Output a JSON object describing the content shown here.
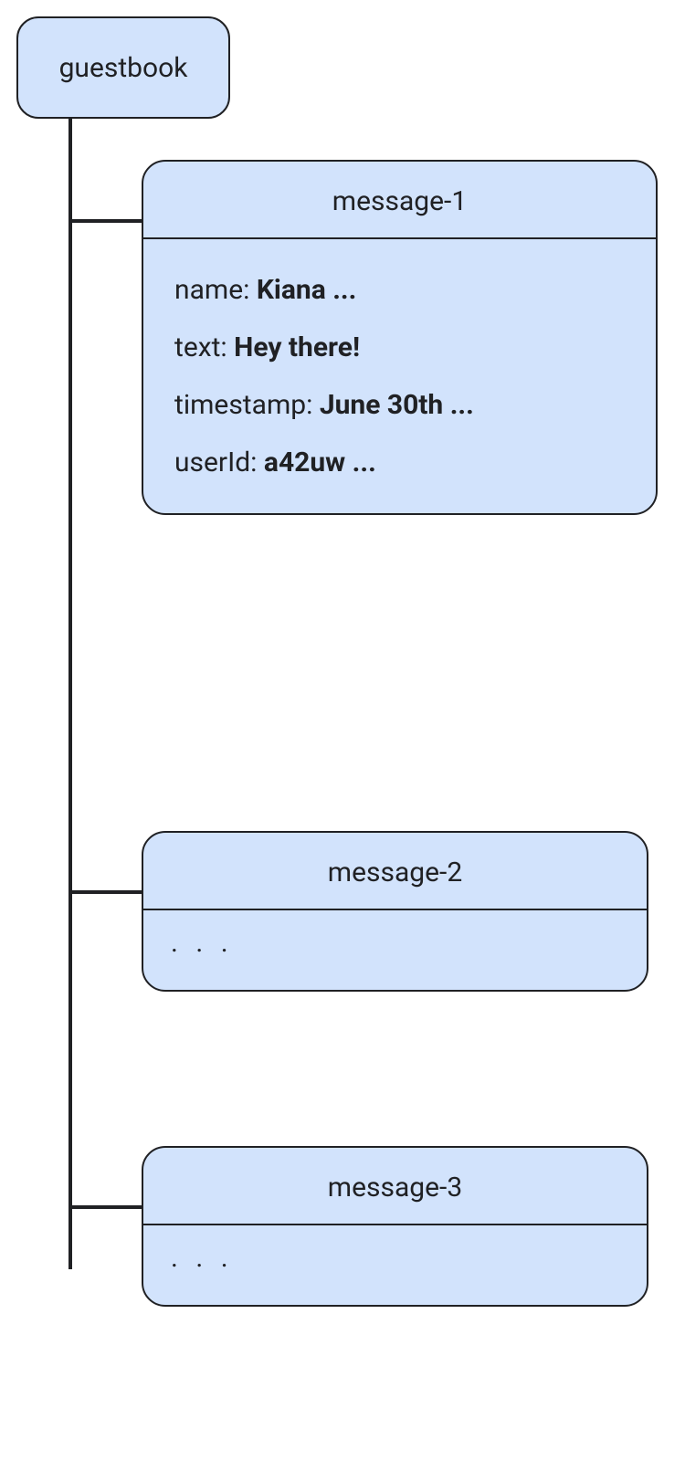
{
  "root": {
    "label": "guestbook"
  },
  "messages": [
    {
      "title": "message-1",
      "fields": [
        {
          "key": "name:",
          "value": "Kiana ..."
        },
        {
          "key": "text:",
          "value": "Hey there!"
        },
        {
          "key": "timestamp:",
          "value": "June 30th ..."
        },
        {
          "key": "userId:",
          "value": "a42uw ..."
        }
      ]
    },
    {
      "title": "message-2",
      "ellipsis": ". . ."
    },
    {
      "title": "message-3",
      "ellipsis": ". . ."
    }
  ]
}
